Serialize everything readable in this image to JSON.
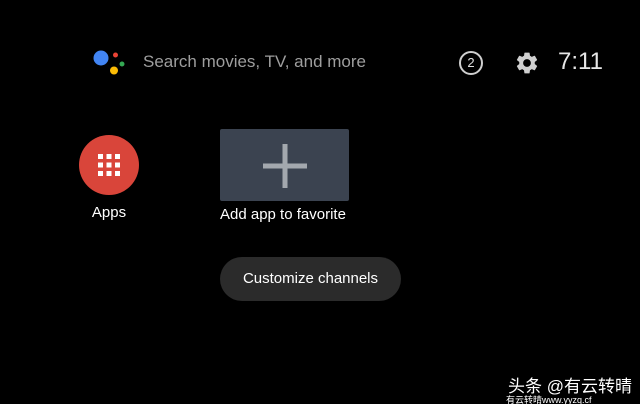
{
  "header": {
    "search_placeholder": "Search movies, TV, and more",
    "notification_count": "2",
    "clock": "7:11"
  },
  "favorites": {
    "apps_label": "Apps",
    "add_label": "Add app to favorite"
  },
  "customize_label": "Customize channels",
  "watermark": {
    "text": "头条 @有云转晴",
    "url": "有云转晴www.yyzq.cf"
  },
  "colors": {
    "background": "#000000",
    "apps_red": "#d9453a",
    "tile_slate": "#3b4350",
    "button_bg": "#2b2b2b",
    "assistant_blue": "#4285f4",
    "assistant_red": "#ea4335",
    "assistant_yellow": "#fbbc05",
    "assistant_green": "#34a853"
  },
  "icons": {
    "assistant": "google-assistant-icon",
    "settings": "gear-icon",
    "apps": "app-grid-icon",
    "add": "plus-icon"
  }
}
